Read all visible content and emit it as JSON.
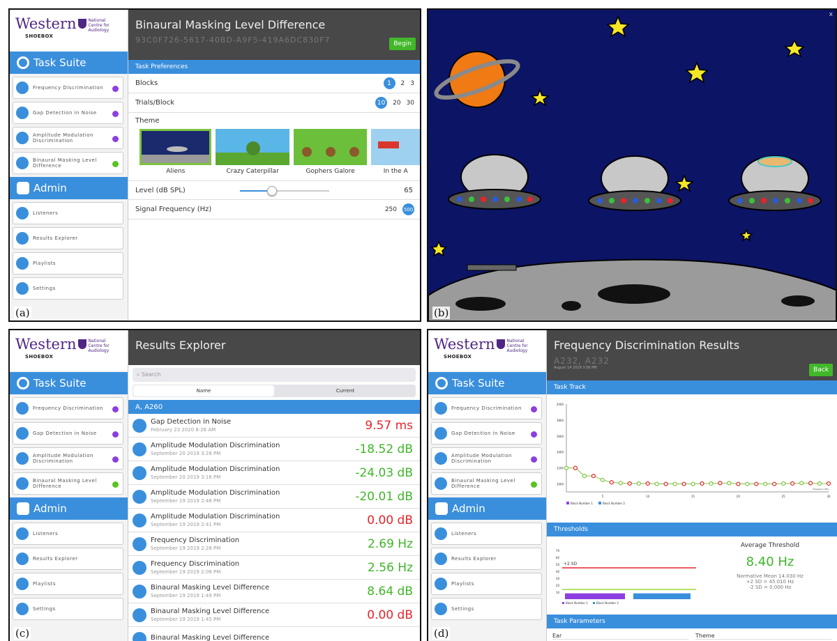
{
  "sidebar": {
    "logo": {
      "wordmark": "Western",
      "nca": "National Centre for Audiology",
      "shoebox": "SHOEBOX"
    },
    "task_suite": "Task Suite",
    "tasks": [
      {
        "label": "Frequency Discrimination",
        "badge": "purple"
      },
      {
        "label": "Gap Detection in Noise",
        "badge": "purple"
      },
      {
        "label": "Amplitude Modulation Discrimination",
        "badge": "purple"
      },
      {
        "label": "Binaural Masking Level Difference",
        "badge": "green"
      }
    ],
    "admin": "Admin",
    "admin_items": [
      "Listeners",
      "Results Explorer",
      "Playlists",
      "Settings"
    ]
  },
  "panel_a": {
    "label": "(a)",
    "title": "Binaural Masking Level Difference",
    "subtitle": "93C0F726-5617-40BD-A9F5-419A6DC830F7",
    "begin": "Begin",
    "prefs": "Task Preferences",
    "blocks_label": "Blocks",
    "blocks": [
      "1",
      "2",
      "3"
    ],
    "trials_label": "Trials/Block",
    "trials": [
      "10",
      "20",
      "30"
    ],
    "theme_label": "Theme",
    "themes": [
      "Aliens",
      "Crazy Caterpillar",
      "Gophers Galore",
      "In the A"
    ],
    "level_label": "Level (dB SPL)",
    "level_value": "65",
    "level_fraction": 0.36,
    "freq_label": "Signal Frequency (Hz)",
    "freq_options": [
      "250",
      "500"
    ]
  },
  "panel_b": {
    "label": "(b)",
    "close": "x"
  },
  "panel_c": {
    "label": "(c)",
    "title": "Results Explorer",
    "search": "Search",
    "seg": [
      "Name",
      "Current"
    ],
    "group": "A, A260",
    "rows": [
      {
        "name": "Gap Detection in Noise",
        "date": "February 23 2020 8:26 AM",
        "value": "9.57 ms",
        "color": "red"
      },
      {
        "name": "Amplitude Modulation Discrimination",
        "date": "September 20 2019 3:28 PM",
        "value": "-18.52 dB",
        "color": "green"
      },
      {
        "name": "Amplitude Modulation Discrimination",
        "date": "September 20 2019 3:16 PM",
        "value": "-24.03 dB",
        "color": "green"
      },
      {
        "name": "Amplitude Modulation Discrimination",
        "date": "September 19 2019 2:46 PM",
        "value": "-20.01 dB",
        "color": "green"
      },
      {
        "name": "Amplitude Modulation Discrimination",
        "date": "September 19 2019 2:41 PM",
        "value": "0.00 dB",
        "color": "red"
      },
      {
        "name": "Frequency Discrimination",
        "date": "September 19 2019 2:28 PM",
        "value": "2.69 Hz",
        "color": "green"
      },
      {
        "name": "Frequency Discrimination",
        "date": "September 19 2019 2:06 PM",
        "value": "2.56 Hz",
        "color": "green"
      },
      {
        "name": "Binaural Masking Level Difference",
        "date": "September 19 2019 1:49 PM",
        "value": "8.64 dB",
        "color": "green"
      },
      {
        "name": "Binaural Masking Level Difference",
        "date": "September 19 2019 1:45 PM",
        "value": "0.00 dB",
        "color": "red"
      },
      {
        "name": "Binaural Masking Level Difference",
        "date": "",
        "value": "",
        "color": "red"
      }
    ]
  },
  "panel_d": {
    "label": "(d)",
    "title": "Frequency Discrimination Results",
    "subtitle": "A232, A232",
    "date": "August 14 2019 3:56 PM",
    "back": "Back",
    "task_track": "Task Track",
    "thresholds": "Thresholds",
    "avg_label": "Average Threshold",
    "avg_value": "8.40 Hz",
    "norm": [
      "Normative Mean 14.030 Hz",
      "+2 SD = 45.010 Hz",
      "-2 SD = 0.000 Hz"
    ],
    "plus2sd": "+2 SD",
    "legend": [
      "Block Number 1",
      "Block Number 2"
    ],
    "task_params": "Task Parameters",
    "param_cols": [
      "Ear",
      "Theme"
    ],
    "chart_data": [
      {
        "type": "line",
        "x": [
          1,
          2,
          3,
          4,
          5,
          6,
          7,
          8,
          9,
          10,
          11,
          12,
          13,
          14,
          15,
          16,
          17,
          18,
          19,
          20,
          21,
          22,
          23,
          24,
          25,
          26,
          27,
          28,
          29,
          30
        ],
        "series": [
          {
            "name": "Block Number 1",
            "values": [
              1200,
              1200,
              1100,
              1100,
              1050,
              1020,
              1010,
              1005,
              1005,
              1005,
              1000,
              1000,
              1000,
              1000,
              1000,
              1005,
              1005,
              1010,
              1010,
              1000,
              1000,
              1000,
              1000,
              1000,
              1005,
              1005,
              1010,
              1010,
              1005,
              1005
            ]
          },
          {
            "name": "Block Number 2",
            "values": [
              1200,
              1200,
              1100,
              1100,
              1050,
              1020,
              1010,
              1005,
              1005,
              1005,
              1000,
              1000,
              1000,
              1000,
              1000,
              1005,
              1005,
              1010,
              1010,
              1000,
              1000,
              1000,
              1000,
              1000,
              1005,
              1005,
              1010,
              1010,
              1005,
              1005
            ]
          }
        ],
        "ylim": [
          900,
          2000
        ],
        "yticks": [
          1000,
          1200,
          1400,
          1600,
          1800,
          2000
        ],
        "xticks": [
          5,
          10,
          15,
          20,
          25,
          30
        ],
        "xlabel": "Frequency (Hz)",
        "colors": [
          "#e6242b",
          "#7fc241"
        ]
      },
      {
        "type": "bar",
        "series": [
          {
            "name": "Block Number 1",
            "values": [
              8.4
            ]
          },
          {
            "name": "Block Number 2",
            "values": [
              8.4
            ]
          }
        ],
        "ylim": [
          0,
          70
        ],
        "yticks": [
          10,
          20,
          30,
          40,
          50,
          60,
          70
        ]
      }
    ]
  }
}
